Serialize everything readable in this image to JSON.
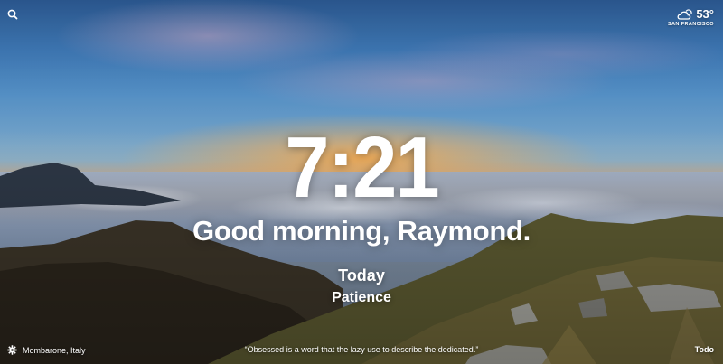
{
  "weather": {
    "temperature": "53°",
    "city": "SAN FRANCISCO",
    "icon": "partly-cloudy-icon"
  },
  "clock": {
    "time": "7:21"
  },
  "greeting": {
    "text": "Good morning, Raymond."
  },
  "focus": {
    "label": "Today",
    "task": "Patience"
  },
  "photo": {
    "location": "Mombarone, Italy"
  },
  "quote": {
    "text": "“Obsessed is a word that the lazy use to describe the dedicated.”"
  },
  "todo": {
    "label": "Todo"
  },
  "icons": {
    "search": "search-icon",
    "settings": "gear-icon"
  },
  "colors": {
    "text": "#ffffff",
    "sunset": "#f6a43f",
    "sky": "#3e78b5"
  }
}
